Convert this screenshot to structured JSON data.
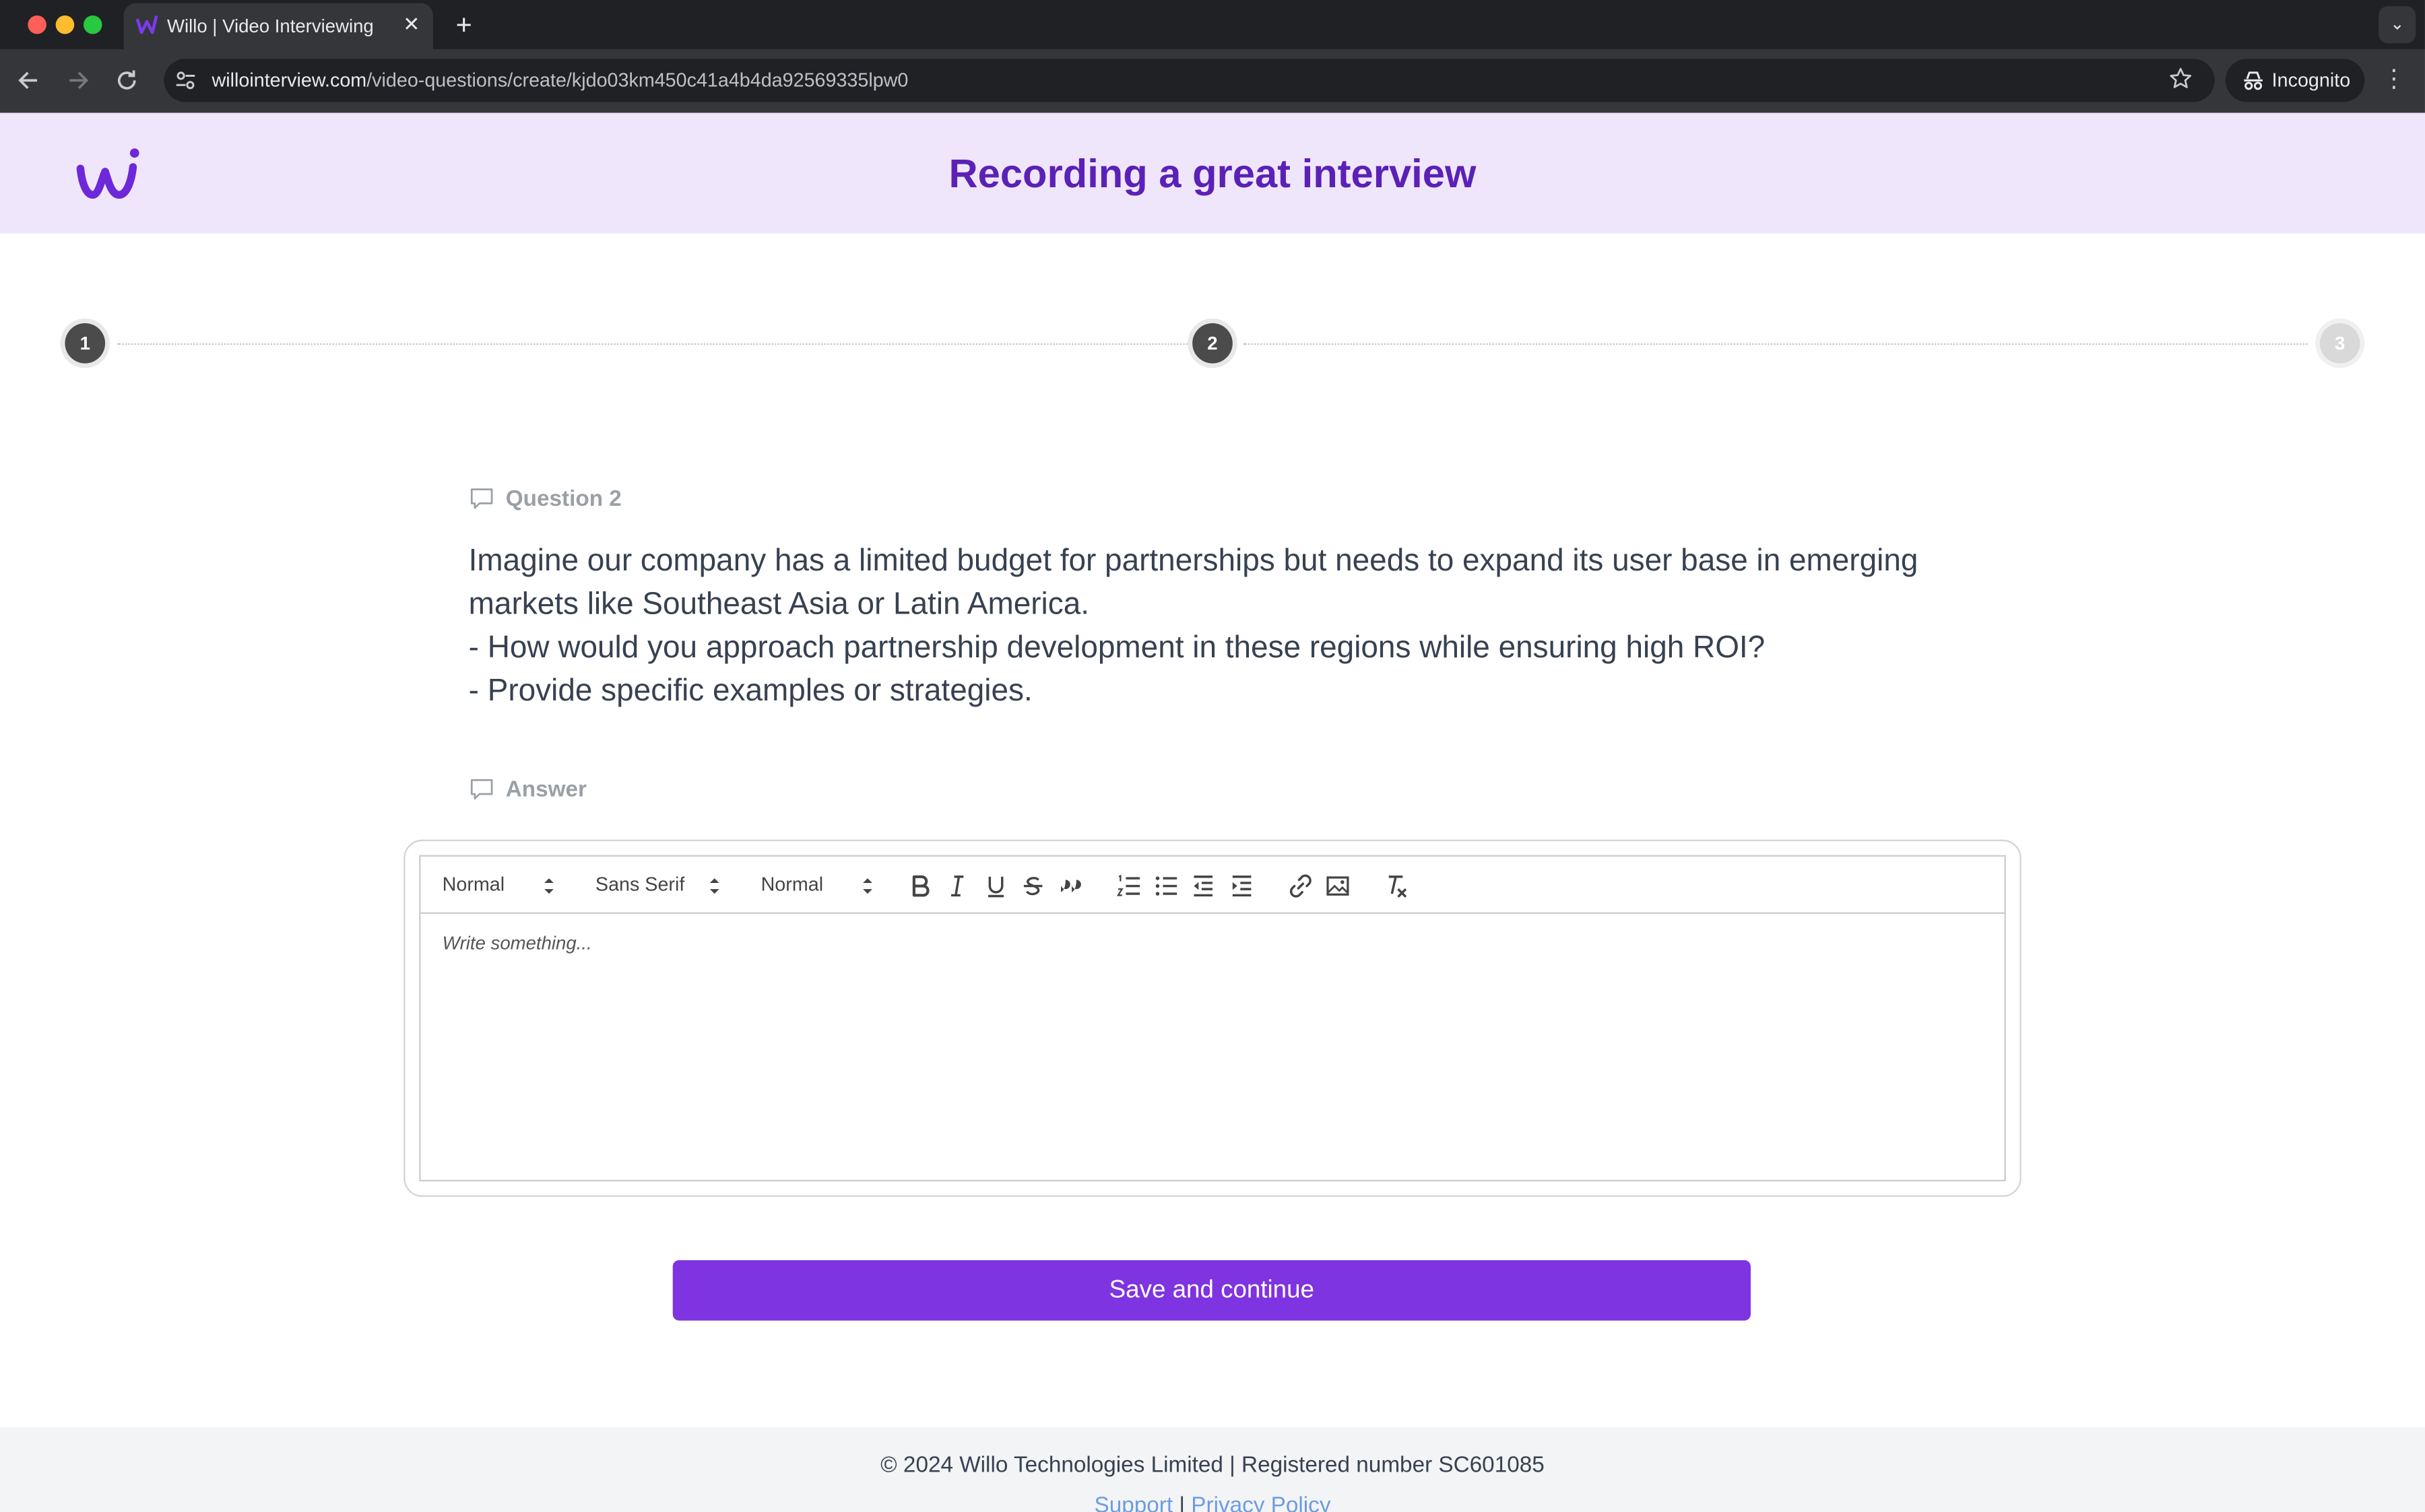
{
  "browser": {
    "tab_title": "Willo | Video Interviewing",
    "url_host": "willointerview.com",
    "url_path": "/video-questions/create/kjdo03km450c41a4b4da92569335lpw0",
    "incognito_label": "Incognito",
    "icons": [
      "back-icon",
      "forward-icon",
      "reload-icon",
      "site-info-icon",
      "star-icon",
      "incognito-icon",
      "menu-icon"
    ]
  },
  "header": {
    "title": "Recording a great interview",
    "brand_color": "#5b21b6"
  },
  "stepper": {
    "steps": [
      "1",
      "2",
      "3"
    ],
    "current_step": 2
  },
  "question": {
    "label": "Question 2",
    "lines": [
      "Imagine our company has a limited budget for partnerships but needs to expand its user base in emerging",
      "markets like Southeast Asia or Latin America.",
      "- How would you approach partnership development in these regions while ensuring high ROI?",
      "- Provide specific examples or strategies."
    ]
  },
  "answer": {
    "label": "Answer",
    "toolbar": {
      "header_picker": "Normal",
      "font_picker": "Sans Serif",
      "size_picker": "Normal",
      "buttons": [
        "bold",
        "italic",
        "underline",
        "strike",
        "blockquote",
        "ordered-list",
        "bullet-list",
        "outdent",
        "indent",
        "link",
        "image",
        "clean"
      ]
    },
    "placeholder": "Write something..."
  },
  "actions": {
    "save_label": "Save and continue",
    "accent_color": "#7e34e0"
  },
  "footer": {
    "copyright": "© 2024 Willo Technologies Limited | Registered number SC601085",
    "support_link": "Support",
    "separator": " | ",
    "privacy_link": "Privacy Policy"
  }
}
